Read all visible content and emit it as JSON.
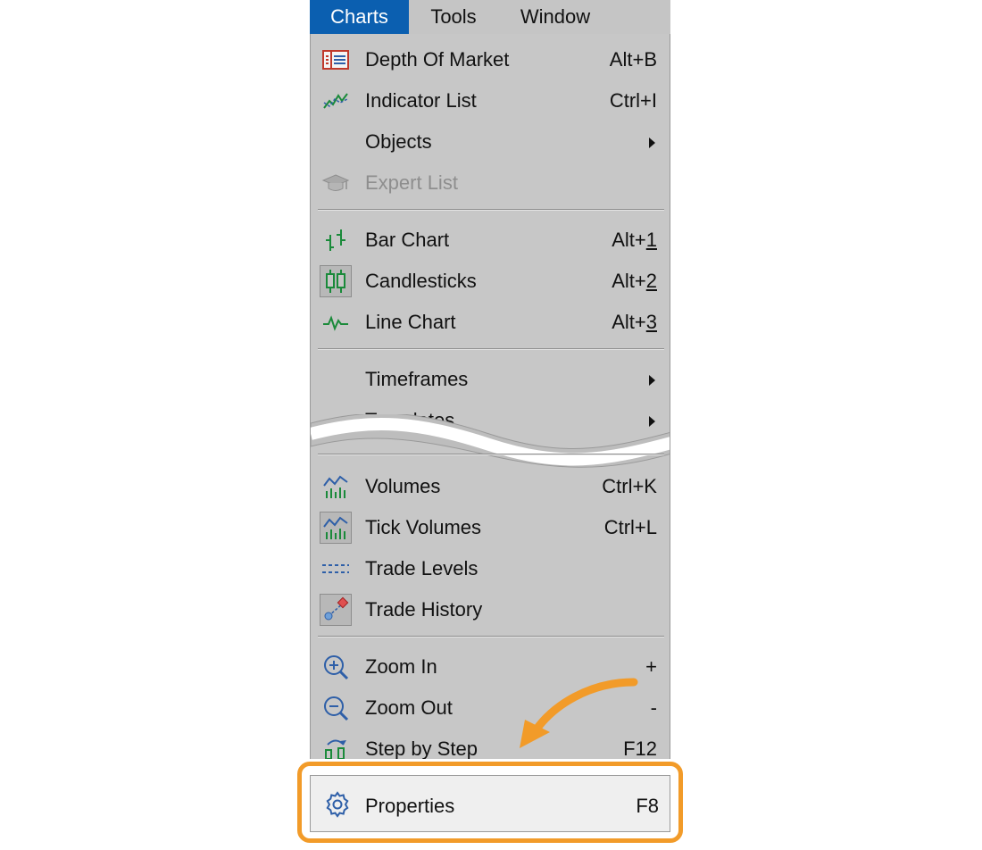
{
  "menubar": {
    "items": [
      {
        "label": "Charts",
        "active": true
      },
      {
        "label": "Tools"
      },
      {
        "label": "Window"
      }
    ]
  },
  "menu": {
    "items": [
      {
        "label": "Depth Of Market",
        "shortcut": "Alt+B",
        "icon": "depth-of-market-icon"
      },
      {
        "label": "Indicator List",
        "shortcut": "Ctrl+I",
        "icon": "indicator-list-icon"
      },
      {
        "label": "Objects",
        "submenu": true
      },
      {
        "label": "Expert List",
        "disabled": true,
        "icon": "graduation-cap-icon"
      },
      {
        "label": "Bar Chart",
        "shortcut_prefix": "Alt+",
        "shortcut_key": "1",
        "icon": "bar-chart-icon"
      },
      {
        "label": "Candlesticks",
        "shortcut_prefix": "Alt+",
        "shortcut_key": "2",
        "icon": "candlesticks-icon",
        "checked": true
      },
      {
        "label": "Line Chart",
        "shortcut_prefix": "Alt+",
        "shortcut_key": "3",
        "icon": "line-chart-icon"
      },
      {
        "label": "Timeframes",
        "submenu": true
      },
      {
        "label": "Templates",
        "submenu": true
      },
      {
        "label": "Volumes",
        "shortcut": "Ctrl+K",
        "icon": "volumes-icon"
      },
      {
        "label": "Tick Volumes",
        "shortcut": "Ctrl+L",
        "icon": "tick-volumes-icon",
        "checked": true
      },
      {
        "label": "Trade Levels",
        "icon": "trade-levels-icon"
      },
      {
        "label": "Trade History",
        "icon": "trade-history-icon",
        "checked": true
      },
      {
        "label": "Zoom In",
        "shortcut": "+",
        "icon": "zoom-in-icon"
      },
      {
        "label": "Zoom Out",
        "shortcut": "-",
        "icon": "zoom-out-icon"
      },
      {
        "label": "Step by Step",
        "shortcut": "F12",
        "icon": "step-by-step-icon"
      }
    ]
  },
  "properties": {
    "label": "Properties",
    "shortcut": "F8",
    "icon": "gear-icon"
  },
  "colors": {
    "menubar_active": "#0b5fb0",
    "menu_background": "#c7c7c7",
    "highlight_border": "#f29b29",
    "arrow": "#f29b29"
  }
}
